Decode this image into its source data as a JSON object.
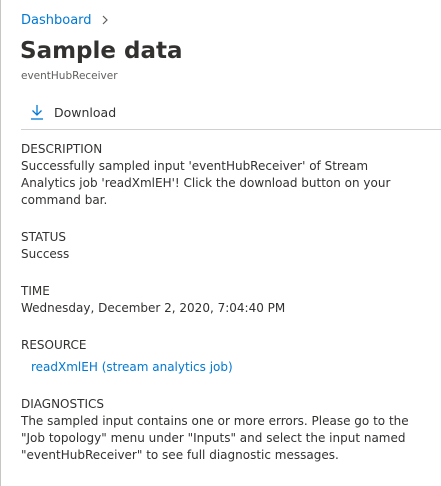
{
  "breadcrumb": {
    "root": "Dashboard"
  },
  "header": {
    "title": "Sample data",
    "subtitle": "eventHubReceiver"
  },
  "commandbar": {
    "download_label": "Download",
    "download_icon": "download-icon"
  },
  "details": {
    "description": {
      "label": "DESCRIPTION",
      "value": "Successfully sampled input 'eventHubReceiver' of Stream Analytics job 'readXmlEH'! Click the download button on your command bar."
    },
    "status": {
      "label": "STATUS",
      "value": "Success"
    },
    "time": {
      "label": "TIME",
      "value": "Wednesday, December 2, 2020, 7:04:40 PM"
    },
    "resource": {
      "label": "RESOURCE",
      "link": "readXmlEH (stream analytics job)"
    },
    "diagnostics": {
      "label": "DIAGNOSTICS",
      "value": "The sampled input contains one or more errors. Please go to the \"Job topology\" menu under \"Inputs\" and select the input named \"eventHubReceiver\" to see full diagnostic messages."
    }
  },
  "colors": {
    "accent": "#0078d4",
    "text": "#323130",
    "muted": "#605e5c"
  }
}
